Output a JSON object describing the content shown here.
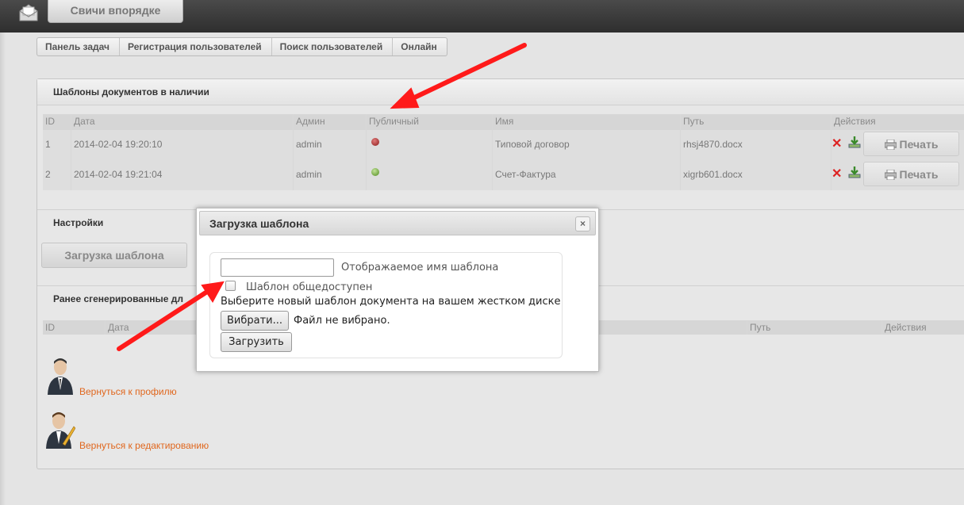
{
  "app": {
    "title": "Свичи впорядке"
  },
  "breadcrumb": [
    "Панель задач",
    "Регистрация пользователей",
    "Поиск пользователей",
    "Онлайн"
  ],
  "templates_section": {
    "title": "Шаблоны документов в наличии",
    "columns": [
      "ID",
      "Дата",
      "Админ",
      "Публичный",
      "Имя",
      "Путь",
      "Действия"
    ],
    "rows": [
      {
        "id": "1",
        "date": "2014-02-04 19:20:10",
        "admin": "admin",
        "public": "no",
        "public_color": "#8b1a1a",
        "name": "Типовой договор",
        "path": "rhsj4870.docx",
        "print": "Печать"
      },
      {
        "id": "2",
        "date": "2014-02-04 19:21:04",
        "admin": "admin",
        "public": "yes",
        "public_color": "#4e8a1c",
        "name": "Счет-Фактура",
        "path": "xigrb601.docx",
        "print": "Печать"
      }
    ]
  },
  "settings_section": {
    "title": "Настройки",
    "upload_button": "Загрузка шаблона"
  },
  "generated_section": {
    "title_visible": "Ранее сгенерированные дл",
    "columns": [
      "ID",
      "Дата",
      "Путь",
      "Действия"
    ]
  },
  "links": {
    "back_profile": "Вернуться к профилю",
    "back_edit": "Вернуться к редактированию"
  },
  "modal": {
    "title": "Загрузка шаблона",
    "close_label": "×",
    "name_label": "Отображаемое имя шаблона",
    "public_label": "Шаблон общедоступен",
    "public_checked": false,
    "hint": "Выберите новый шаблон документа на вашем жестком диске",
    "file_button": "Вибрати...",
    "file_status": "Файл не вибрано.",
    "submit": "Загрузить"
  },
  "colors": {
    "link": "#e0671e",
    "annotation_arrow": "#ff0000"
  }
}
